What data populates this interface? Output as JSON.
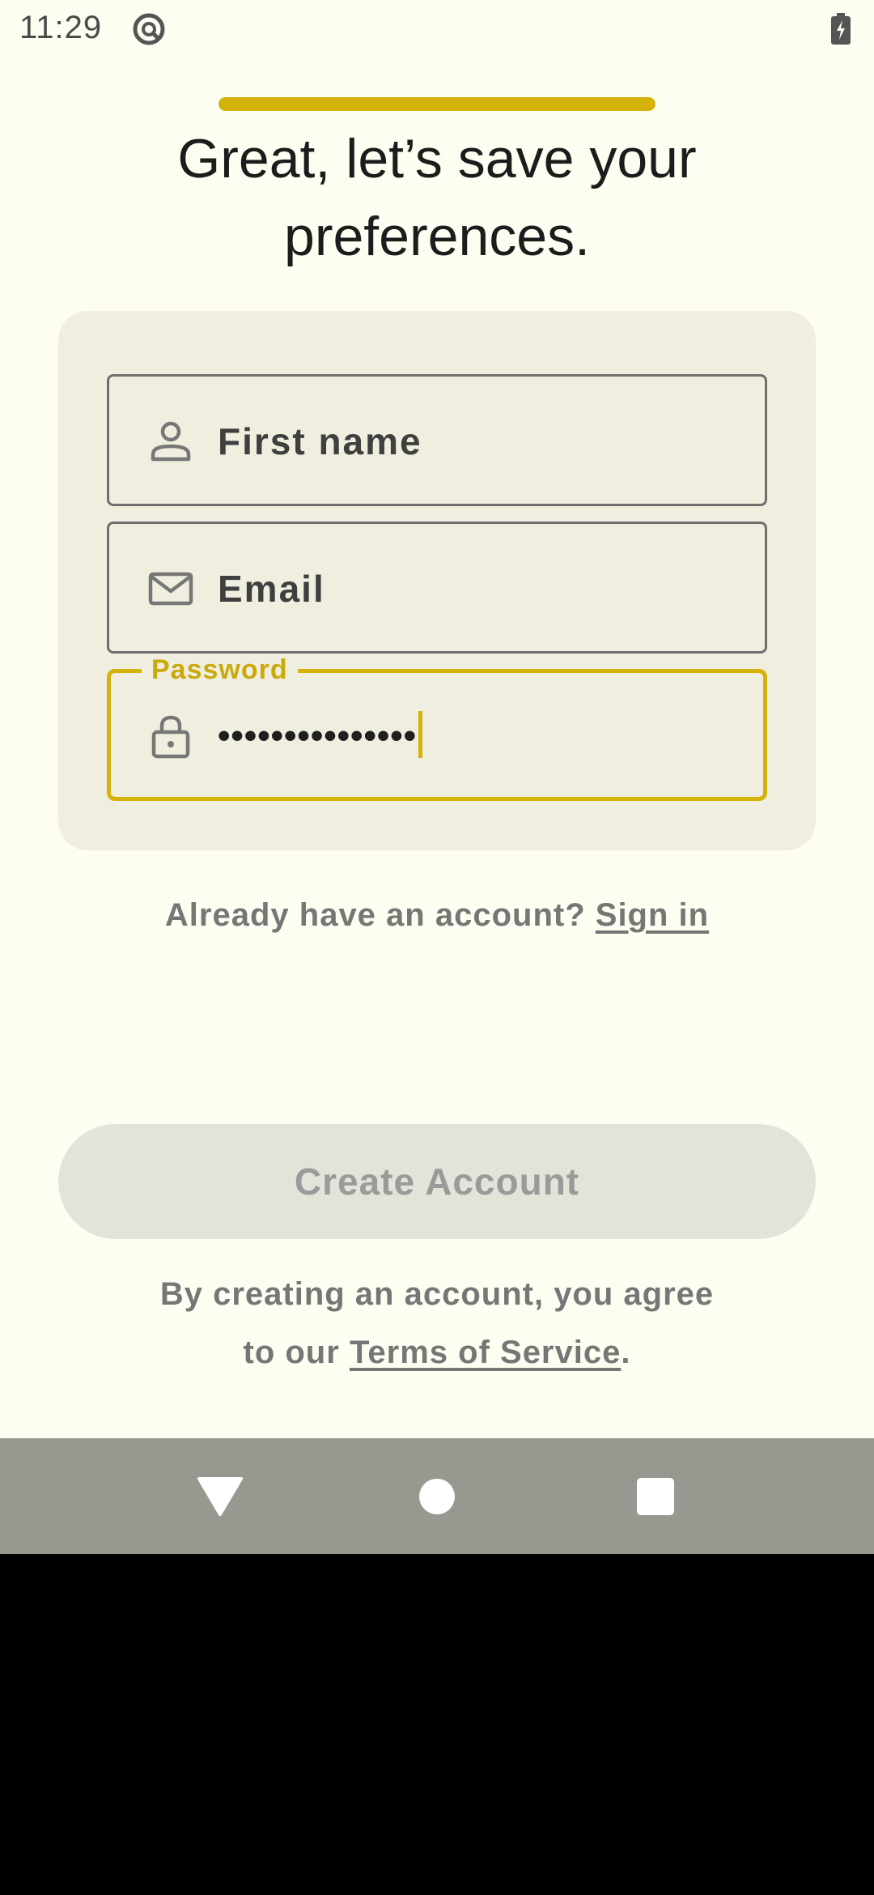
{
  "status_bar": {
    "time": "11:29",
    "app_icon": "sync-circle-icon",
    "battery_icon": "battery-charging-icon"
  },
  "progress": {
    "value_percent": 100,
    "color": "#D4B20A"
  },
  "page": {
    "title": "Great, let’s save your preferences."
  },
  "form": {
    "first_name": {
      "placeholder": "First name",
      "icon": "person-icon"
    },
    "email": {
      "placeholder": "Email",
      "icon": "mail-icon"
    },
    "password": {
      "label": "Password",
      "value_masked": "•••••••••••••••",
      "icon": "lock-icon"
    }
  },
  "signin": {
    "prompt": "Already have an account?",
    "link": "Sign in"
  },
  "create_button": {
    "label": "Create Account"
  },
  "terms": {
    "line1": "By creating an account, you agree",
    "prefix": "to our",
    "link": "Terms of Service",
    "suffix": "."
  },
  "colors": {
    "background": "#FDFDF1",
    "card": "#EFEEDF",
    "accent": "#D4B20A",
    "muted_text": "#767676"
  }
}
